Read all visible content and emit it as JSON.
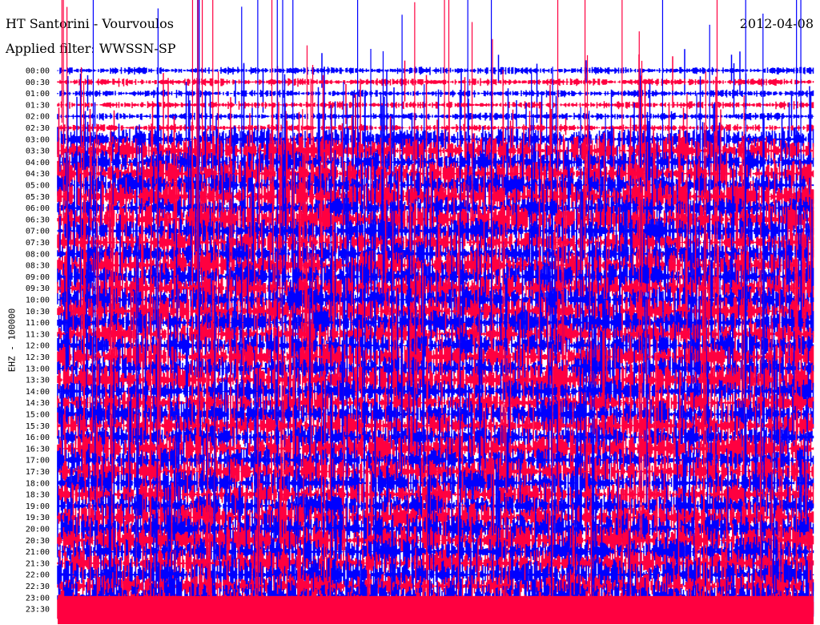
{
  "chart_data": {
    "type": "line",
    "title": "HT Santorini - Vourvoulos",
    "filter": "Applied filter: WWSSN-SP",
    "date": "2012-04-08",
    "ylabel": "EHZ - 100000",
    "row_labels": [
      "00:00",
      "00:30",
      "01:00",
      "01:30",
      "02:00",
      "02:30",
      "03:00",
      "03:30",
      "04:00",
      "04:30",
      "05:00",
      "05:30",
      "06:00",
      "06:30",
      "07:00",
      "07:30",
      "08:00",
      "08:30",
      "09:00",
      "09:30",
      "10:00",
      "10:30",
      "11:00",
      "11:30",
      "12:00",
      "12:30",
      "13:00",
      "13:30",
      "14:00",
      "14:30",
      "15:00",
      "15:30",
      "16:00",
      "16:30",
      "17:00",
      "17:30",
      "18:00",
      "18:30",
      "19:00",
      "19:30",
      "20:00",
      "20:30",
      "21:00",
      "21:30",
      "22:00",
      "22:30",
      "23:00",
      "23:30"
    ],
    "row_minutes": 30,
    "series_colors": [
      "#0000ff",
      "#ff0040"
    ],
    "relative_amplitude": {
      "00:00-02:30": "low",
      "03:00-23:30": "high"
    }
  }
}
